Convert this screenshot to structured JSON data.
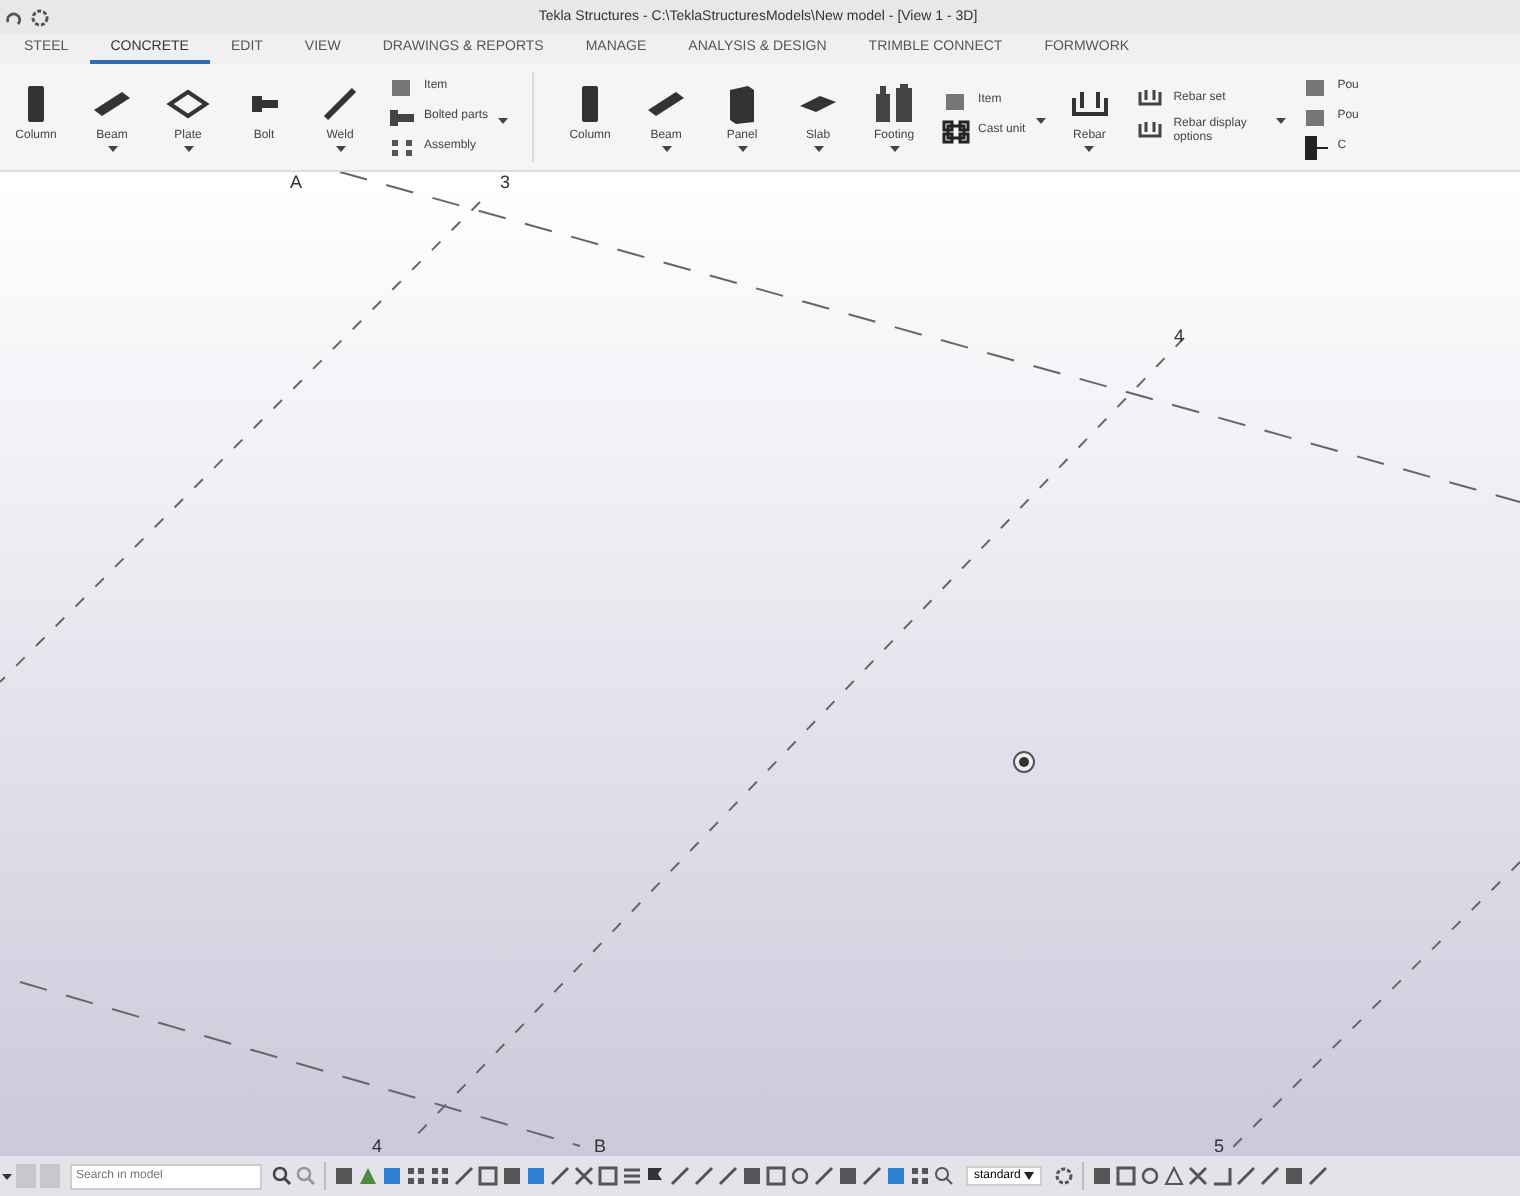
{
  "window": {
    "title": "Tekla Structures - C:\\TeklaStructuresModels\\New model - [View 1 - 3D]"
  },
  "tabs": [
    {
      "label": "STEEL",
      "selected": false
    },
    {
      "label": "CONCRETE",
      "selected": true
    },
    {
      "label": "EDIT",
      "selected": false
    },
    {
      "label": "VIEW",
      "selected": false
    },
    {
      "label": "DRAWINGS & REPORTS",
      "selected": false
    },
    {
      "label": "MANAGE",
      "selected": false
    },
    {
      "label": "ANALYSIS & DESIGN",
      "selected": false
    },
    {
      "label": "TRIMBLE CONNECT",
      "selected": false
    },
    {
      "label": "FORMWORK",
      "selected": false
    }
  ],
  "ribbon_groups": [
    {
      "items": [
        {
          "kind": "column",
          "label": "Column",
          "has_menu": false
        },
        {
          "kind": "beam",
          "label": "Beam",
          "has_menu": true
        },
        {
          "kind": "plate",
          "label": "Plate",
          "has_menu": true
        },
        {
          "kind": "bolt",
          "label": "Bolt",
          "has_menu": false
        },
        {
          "kind": "weld",
          "label": "Weld",
          "has_menu": true
        },
        {
          "kind": "stack",
          "entries": [
            {
              "kind": "item",
              "label": "Item"
            },
            {
              "kind": "bolted",
              "label": "Bolted parts"
            },
            {
              "kind": "assembly",
              "label": "Assembly"
            }
          ],
          "has_menu": true
        }
      ]
    },
    {
      "items": [
        {
          "kind": "column",
          "label": "Column",
          "has_menu": false
        },
        {
          "kind": "beam",
          "label": "Beam",
          "has_menu": true
        },
        {
          "kind": "panel",
          "label": "Panel",
          "has_menu": true
        },
        {
          "kind": "slab",
          "label": "Slab",
          "has_menu": true
        },
        {
          "kind": "footing",
          "label": "Footing",
          "has_menu": true
        },
        {
          "kind": "stack",
          "entries": [
            {
              "kind": "item",
              "label": "Item"
            },
            {
              "kind": "castunit",
              "label": "Cast unit"
            }
          ],
          "has_menu": true
        },
        {
          "kind": "rebar",
          "label": "Rebar",
          "has_menu": true
        },
        {
          "kind": "stack",
          "entries": [
            {
              "kind": "rebarset",
              "label": "Rebar set"
            },
            {
              "kind": "rebardisplay",
              "label": "Rebar display options"
            }
          ],
          "has_menu": true
        },
        {
          "kind": "stack",
          "entries": [
            {
              "kind": "pour",
              "label": "Pou"
            },
            {
              "kind": "pour",
              "label": "Pou"
            },
            {
              "kind": "cut",
              "label": "C"
            }
          ],
          "has_menu": false
        }
      ]
    }
  ],
  "grid_labels": [
    {
      "label": "A"
    },
    {
      "label": "3"
    },
    {
      "label": "4"
    },
    {
      "label": "4"
    },
    {
      "label": "B"
    },
    {
      "label": "5"
    }
  ],
  "bottom_bar": {
    "search": {
      "placeholder": "Search in model"
    },
    "view_filter": {
      "value": "standard"
    }
  }
}
